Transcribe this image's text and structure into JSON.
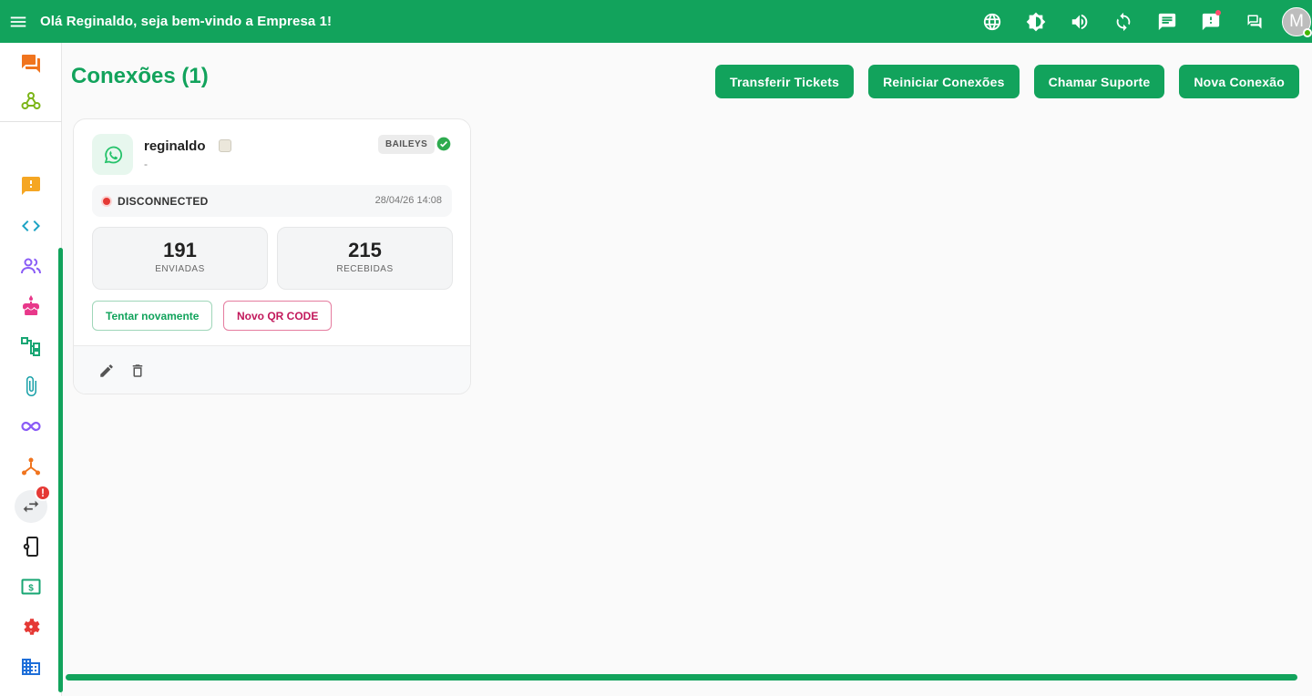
{
  "topbar": {
    "greeting": "Olá Reginaldo, seja bem-vindo a Empresa 1!",
    "avatar_initial": "M",
    "icons": [
      "globe-icon",
      "brightness-icon",
      "volume-icon",
      "refresh-icon",
      "chat-icon",
      "alert-chat-icon",
      "forum-icon"
    ]
  },
  "sidebar": {
    "items": [
      "chat-icon",
      "webhook-icon",
      "alert-icon",
      "code-icon",
      "users-icon",
      "cake-icon",
      "flow-icon",
      "attachment-icon",
      "infinity-icon",
      "hub-icon",
      "transfer-icon",
      "phone-settings-icon",
      "money-icon",
      "settings-icon",
      "company-icon"
    ],
    "badge": "!"
  },
  "page": {
    "title": "Conexões (1)",
    "buttons": {
      "transfer": "Transferir Tickets",
      "restart": "Reiniciar Conexões",
      "support": "Chamar Suporte",
      "new": "Nova Conexão"
    }
  },
  "connection": {
    "name": "reginaldo",
    "subtitle": "-",
    "tag": "BAILEYS",
    "status": "DISCONNECTED",
    "updated_at": "28/04/26 14:08",
    "sent": {
      "value": "191",
      "label": "ENVIADAS"
    },
    "received": {
      "value": "215",
      "label": "RECEBIDAS"
    },
    "retry_label": "Tentar novamente",
    "qr_label": "Novo QR CODE"
  },
  "colors": {
    "brand": "#12a35c",
    "danger": "#e53935",
    "pink": "#c2185b"
  }
}
